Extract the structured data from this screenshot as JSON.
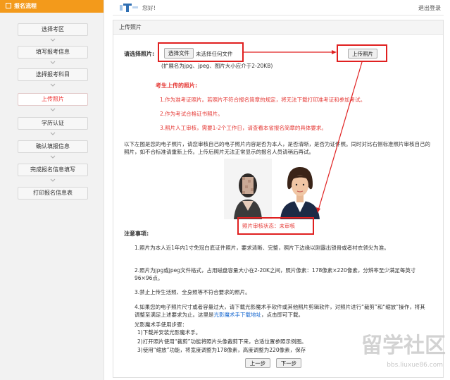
{
  "sidebar": {
    "title": "报名流程",
    "steps": [
      {
        "label": "选择考区"
      },
      {
        "label": "填写报考信息"
      },
      {
        "label": "选择报考科目"
      },
      {
        "label": "上传照片"
      },
      {
        "label": "学历认证"
      },
      {
        "label": "确认填报信息"
      },
      {
        "label": "完成报名信息填写"
      },
      {
        "label": "打印报名信息表"
      }
    ],
    "active_index": 3
  },
  "header": {
    "greeting": "您好!",
    "logout": "退出登录"
  },
  "panel": {
    "title": "上传照片",
    "choose_label": "请选择照片:",
    "choose_button": "选择文件",
    "no_file_text": "未选择任何文件",
    "upload_button": "上传照片",
    "ext_hint": "(扩展名为jpg、jpeg、图片大小应介于2-20KB)",
    "notice_title": "考生上传的照片:",
    "notice_items": [
      "1.作为准考证照片。若照片不符合报名简章的规定，将无法下载打印准考证和参加考试。",
      "2.作为考试合格证书照片。",
      "3.照片人工审核，需要1-2个工作日，请查看本省报名简章的具体要求。"
    ],
    "compare_text": "以下左图是您的电子照片，请您审核自己的电子照片内容是否为本人，是否清晰，是否为证件照。同时对比右侧标准照片审核自己的照片，如不合标准请重新上传。上传后照片无法正常显示的报名人员请稍后再试。",
    "status_text": "照片审核状态：未审核",
    "notes_title": "注意事项:",
    "notes": [
      "1.照片为本人近1年内1寸免冠白底证件照片，要求清晰、完整，照片下边缘以刚露出锁骨或者衬衣领尖为准。",
      "2.照片为jpg或jpeg文件格式，占用磁盘容量大小在2-20K之间，照片像素：178像素×220像素，分辨率至少满足每英寸96×96点。",
      "3.禁止上传生活照、全身照等不符合要求的照片。"
    ],
    "note4_main": "4.如果您的电子照片尺寸或者容量过大，请下载光影魔术手软件或其他照片剪辑软件，对照片进行“裁剪”和“缩放”操作，将其调整至满足上述要求为止。这里是",
    "note4_link": "光影魔术手下载地址",
    "note4_tail": "，点击即可下载。",
    "note4_sub": "光影魔术手使用步骤：",
    "note4_steps": [
      "1)下载并安装光影魔术手。",
      "2)打开照片使用“裁剪”功能将照片头像裁剪下来，合适位置参照示例图。",
      "3)使用“缩放”功能，将宽度调整为178像素，高度调整为220像素，保存"
    ],
    "prev_button": "上一步",
    "next_button": "下一步"
  },
  "watermark": {
    "text": "留学社区",
    "url": "bbs.liuxue86.com"
  },
  "colors": {
    "sidebar_header": "#f39a1b",
    "highlight_red": "#e02020",
    "link_blue": "#1a6ad0"
  }
}
